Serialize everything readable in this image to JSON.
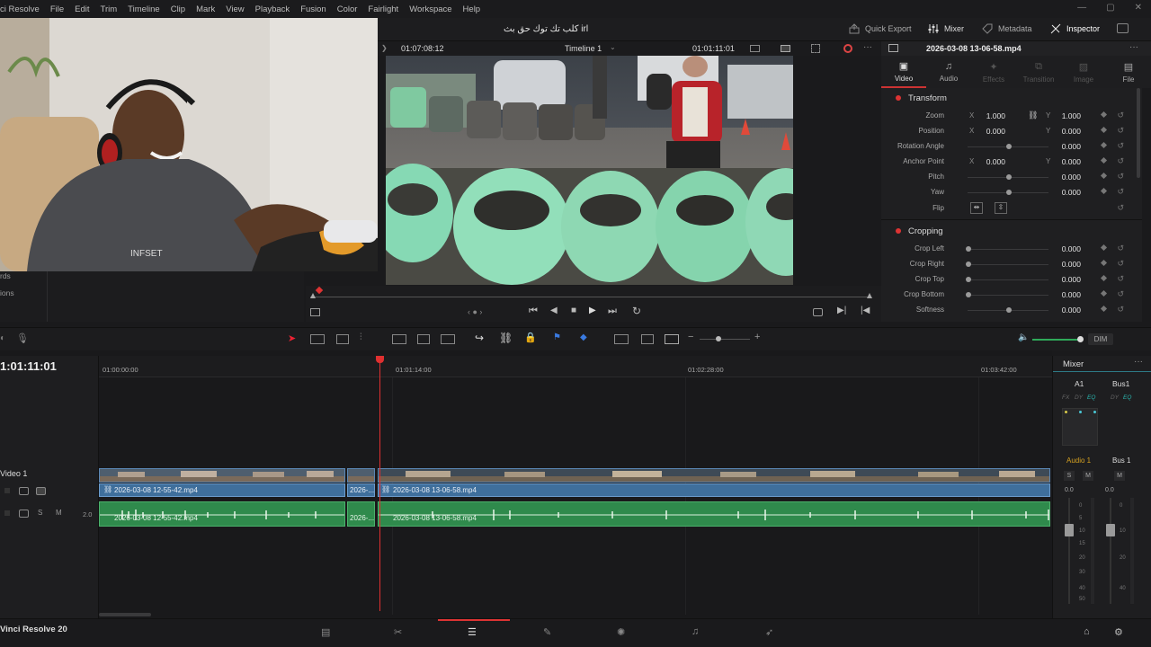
{
  "menubar": {
    "app_fragment": "ci Resolve",
    "items": [
      "File",
      "Edit",
      "Trim",
      "Timeline",
      "Clip",
      "Mark",
      "View",
      "Playback",
      "Fusion",
      "Color",
      "Fairlight",
      "Workspace",
      "Help"
    ]
  },
  "topbar": {
    "project_title": "كلب تك توك حق بث irl",
    "quick_export": "Quick Export",
    "mixer": "Mixer",
    "metadata": "Metadata",
    "inspector": "Inspector"
  },
  "viewer": {
    "source_timecode": "01:07:08:12",
    "timeline_name": "Timeline 1",
    "record_timecode": "01:01:11:01"
  },
  "left_panel": {
    "item1_fragment": "rds",
    "item2_fragment": "ions"
  },
  "inspector": {
    "clip_name": "2026-03-08 13-06-58.mp4",
    "tabs": [
      "Video",
      "Audio",
      "Effects",
      "Transition",
      "Image",
      "File"
    ],
    "transform_title": "Transform",
    "cropping_title": "Cropping",
    "transform": {
      "zoom_label": "Zoom",
      "zoom_x": "1.000",
      "zoom_y": "1.000",
      "position_label": "Position",
      "position_x": "0.000",
      "position_y": "0.000",
      "rotation_label": "Rotation Angle",
      "rotation": "0.000",
      "anchor_label": "Anchor Point",
      "anchor_x": "0.000",
      "anchor_y": "0.000",
      "pitch_label": "Pitch",
      "pitch": "0.000",
      "yaw_label": "Yaw",
      "yaw": "0.000",
      "flip_label": "Flip"
    },
    "cropping": {
      "left_label": "Crop Left",
      "left": "0.000",
      "right_label": "Crop Right",
      "right": "0.000",
      "top_label": "Crop Top",
      "top": "0.000",
      "bottom_label": "Crop Bottom",
      "bottom": "0.000",
      "softness_label": "Softness",
      "softness": "0.000"
    },
    "axis_x": "X",
    "axis_y": "Y"
  },
  "timeline": {
    "timecode": "1:01:11:01",
    "ruler": [
      "01:00:00:00",
      "01:01:14:00",
      "01:02:28:00",
      "01:03:42:00"
    ],
    "dim_label": "DIM",
    "video_track": "Video 1",
    "audio_level": "2.0",
    "clips_video": [
      "2026-03-08 12-55-42.mp4",
      "2026-...",
      "2026-03-08 13-06-58.mp4"
    ],
    "clips_audio": [
      "2026-03-08 12-55-42.mp4",
      "2026-...",
      "2026-03-08 13-06-58.mp4"
    ],
    "solo": "S",
    "mute": "M"
  },
  "mixer": {
    "title": "Mixer",
    "ch_a1": "A1",
    "ch_bus1": "Bus1",
    "fx": "FX",
    "dy": "DY",
    "eq": "EQ",
    "audio1": "Audio 1",
    "bus1_label": "Bus 1",
    "s": "S",
    "m": "M",
    "level_a": "0.0",
    "level_b": "0.0",
    "scale": [
      "0",
      "5",
      "10",
      "15",
      "20",
      "30",
      "40",
      "50"
    ]
  },
  "bottom": {
    "app_name": "Vinci Resolve 20"
  }
}
